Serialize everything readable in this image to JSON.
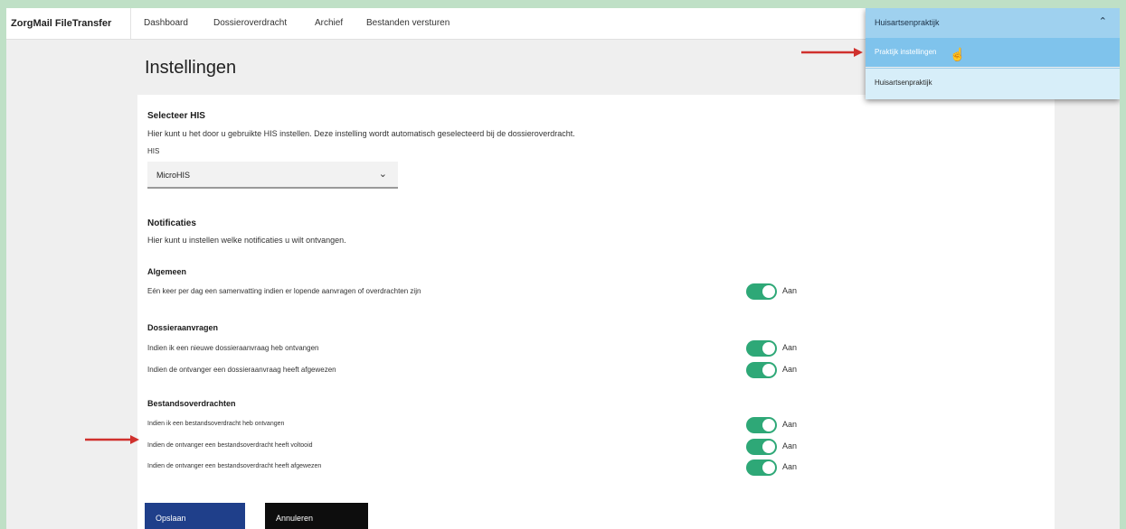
{
  "app": {
    "brand": "ZorgMail FileTransfer"
  },
  "nav": {
    "items": [
      {
        "label": "Dashboard"
      },
      {
        "label": "Dossieroverdracht"
      },
      {
        "label": "Archief"
      },
      {
        "label": "Bestanden versturen"
      }
    ]
  },
  "page": {
    "title": "Instellingen"
  },
  "his": {
    "heading": "Selecteer HIS",
    "description": "Hier kunt u het door u gebruikte HIS instellen. Deze instelling wordt automatisch geselecteerd bij de dossieroverdracht.",
    "field_label": "HIS",
    "selected": "MicroHIS"
  },
  "notifications": {
    "heading": "Notificaties",
    "description": "Hier kunt u instellen welke notificaties u wilt ontvangen.",
    "toggle_label": "Aan",
    "groups": [
      {
        "title": "Algemeen",
        "items": [
          {
            "label": "Eén keer per dag een samenvatting indien er lopende aanvragen of overdrachten zijn",
            "on": true
          }
        ]
      },
      {
        "title": "Dossieraanvragen",
        "items": [
          {
            "label": "Indien ik een nieuwe dossieraanvraag heb ontvangen",
            "on": true
          },
          {
            "label": "Indien de ontvanger een dossieraanvraag heeft afgewezen",
            "on": true
          }
        ]
      },
      {
        "title": "Bestandsoverdrachten",
        "items": [
          {
            "label": "Indien ik een bestandsoverdracht heb ontvangen",
            "on": true
          },
          {
            "label": "Indien de ontvanger een bestandsoverdracht heeft voltooid",
            "on": true
          },
          {
            "label": "Indien de ontvanger een bestandsoverdracht heeft afgewezen",
            "on": true
          }
        ]
      }
    ]
  },
  "actions": {
    "save_label": "Opslaan",
    "cancel_label": "Annuleren"
  },
  "practice_menu": {
    "current": "Huisartsenpraktijk",
    "items": [
      {
        "label": "Praktijk instellingen"
      },
      {
        "label": "Huisartsenpraktijk"
      }
    ]
  },
  "colors": {
    "toggle_on": "#2ea877",
    "primary_button": "#1f3f8a",
    "cancel_button": "#0d0d0d",
    "menu_header": "#9fd1ef",
    "menu_selected": "#7fc3ec",
    "annotation_arrow": "#d0312d"
  },
  "icons": {
    "select_chevron": "chevron-down-icon",
    "menu_chevron": "chevron-up-icon",
    "cursor": "hand-pointer-icon",
    "annotation": "red-arrow-icon"
  }
}
